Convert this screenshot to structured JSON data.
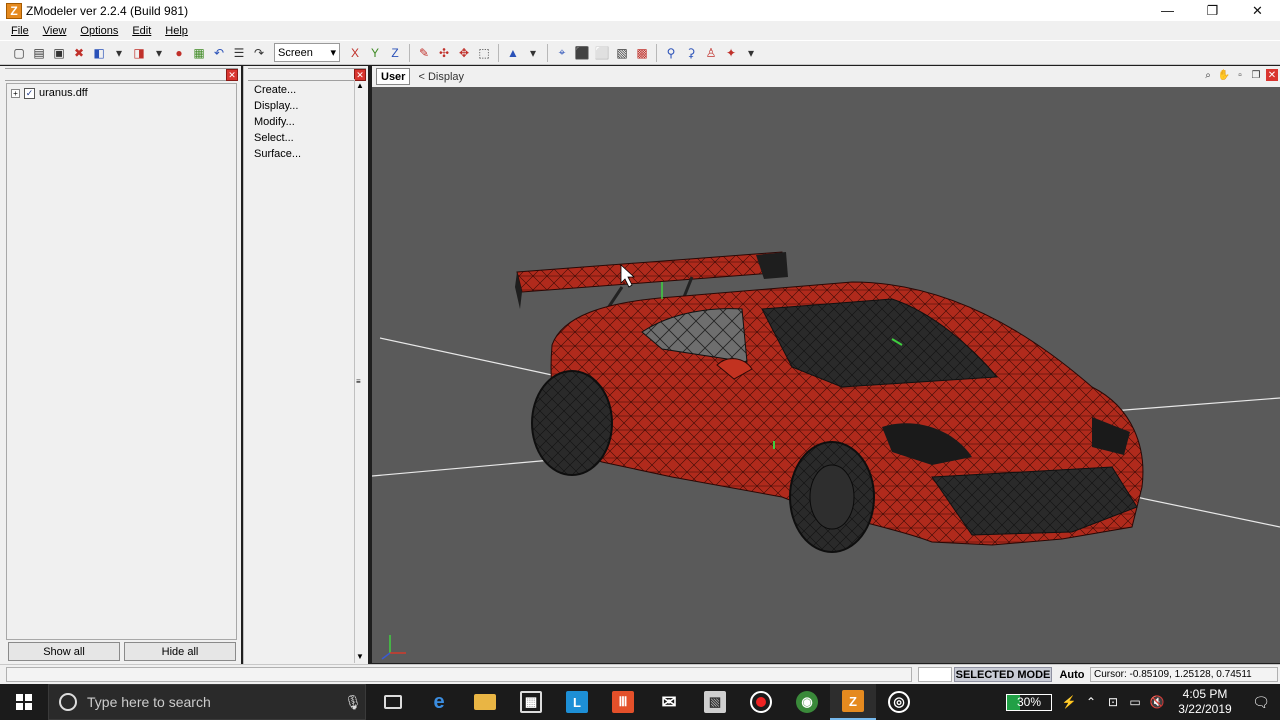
{
  "window": {
    "app_icon_letter": "Z",
    "title": "ZModeler ver 2.2.4 (Build 981)",
    "controls": {
      "minimize": "—",
      "restore": "❐",
      "close": "✕"
    }
  },
  "menu": [
    "File",
    "View",
    "Options",
    "Edit",
    "Help"
  ],
  "toolbar": {
    "coord_mode": "Screen",
    "axis_x": "X",
    "axis_y": "Y",
    "axis_z": "Z"
  },
  "scene_tree": {
    "items": [
      {
        "label": "uranus.dff",
        "checked": true
      }
    ],
    "show_all_label": "Show all",
    "hide_all_label": "Hide all"
  },
  "commands": {
    "items": [
      "Create...",
      "Display...",
      "Modify...",
      "Select...",
      "Surface..."
    ]
  },
  "viewport": {
    "view_name": "User",
    "breadcrumb": "< Display",
    "background": "#5a5a5a",
    "mesh_color": "#b02a1c"
  },
  "status": {
    "mode": "SELECTED MODE",
    "auto": "Auto",
    "cursor": "Cursor: -0.85109, 1.25128, 0.74511"
  },
  "taskbar": {
    "search_placeholder": "Type here to search",
    "battery": "30%",
    "battery_level": 0.3,
    "time": "4:05 PM",
    "date": "3/22/2019"
  }
}
